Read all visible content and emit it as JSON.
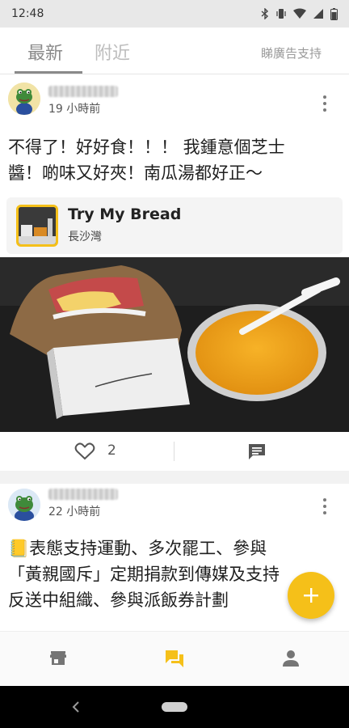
{
  "status_bar": {
    "time": "12:48"
  },
  "top_tabs": {
    "tabs": [
      {
        "label": "最新",
        "active": true
      },
      {
        "label": "附近",
        "active": false
      }
    ],
    "promo_link": "睇廣告支持"
  },
  "posts": [
    {
      "time": "19 小時前",
      "text_lines": [
        "不得了！好好食！！！ 我鍾意個芝士",
        "醬！啲味又好夾！南瓜湯都好正～"
      ],
      "shop": {
        "name": "Try My Bread",
        "area": "長沙灣"
      },
      "likes": "2"
    },
    {
      "time": "22 小時前",
      "text_lines": [
        "📒表態支持運動、多次罷工、參與",
        "「黃親國斥」定期捐款到傳媒及支持",
        "反送中組織、參與派飯券計劃"
      ]
    }
  ],
  "colors": {
    "accent": "#f5c019",
    "tab_active": "#8a8a8a",
    "tab_inactive": "#bdbdbd"
  },
  "icons": {
    "like": "heart-outline-icon",
    "comment": "comment-icon",
    "fab": "plus-icon",
    "nav": [
      "store-icon",
      "forum-icon",
      "person-icon"
    ],
    "system": [
      "back-icon",
      "home-icon"
    ]
  }
}
